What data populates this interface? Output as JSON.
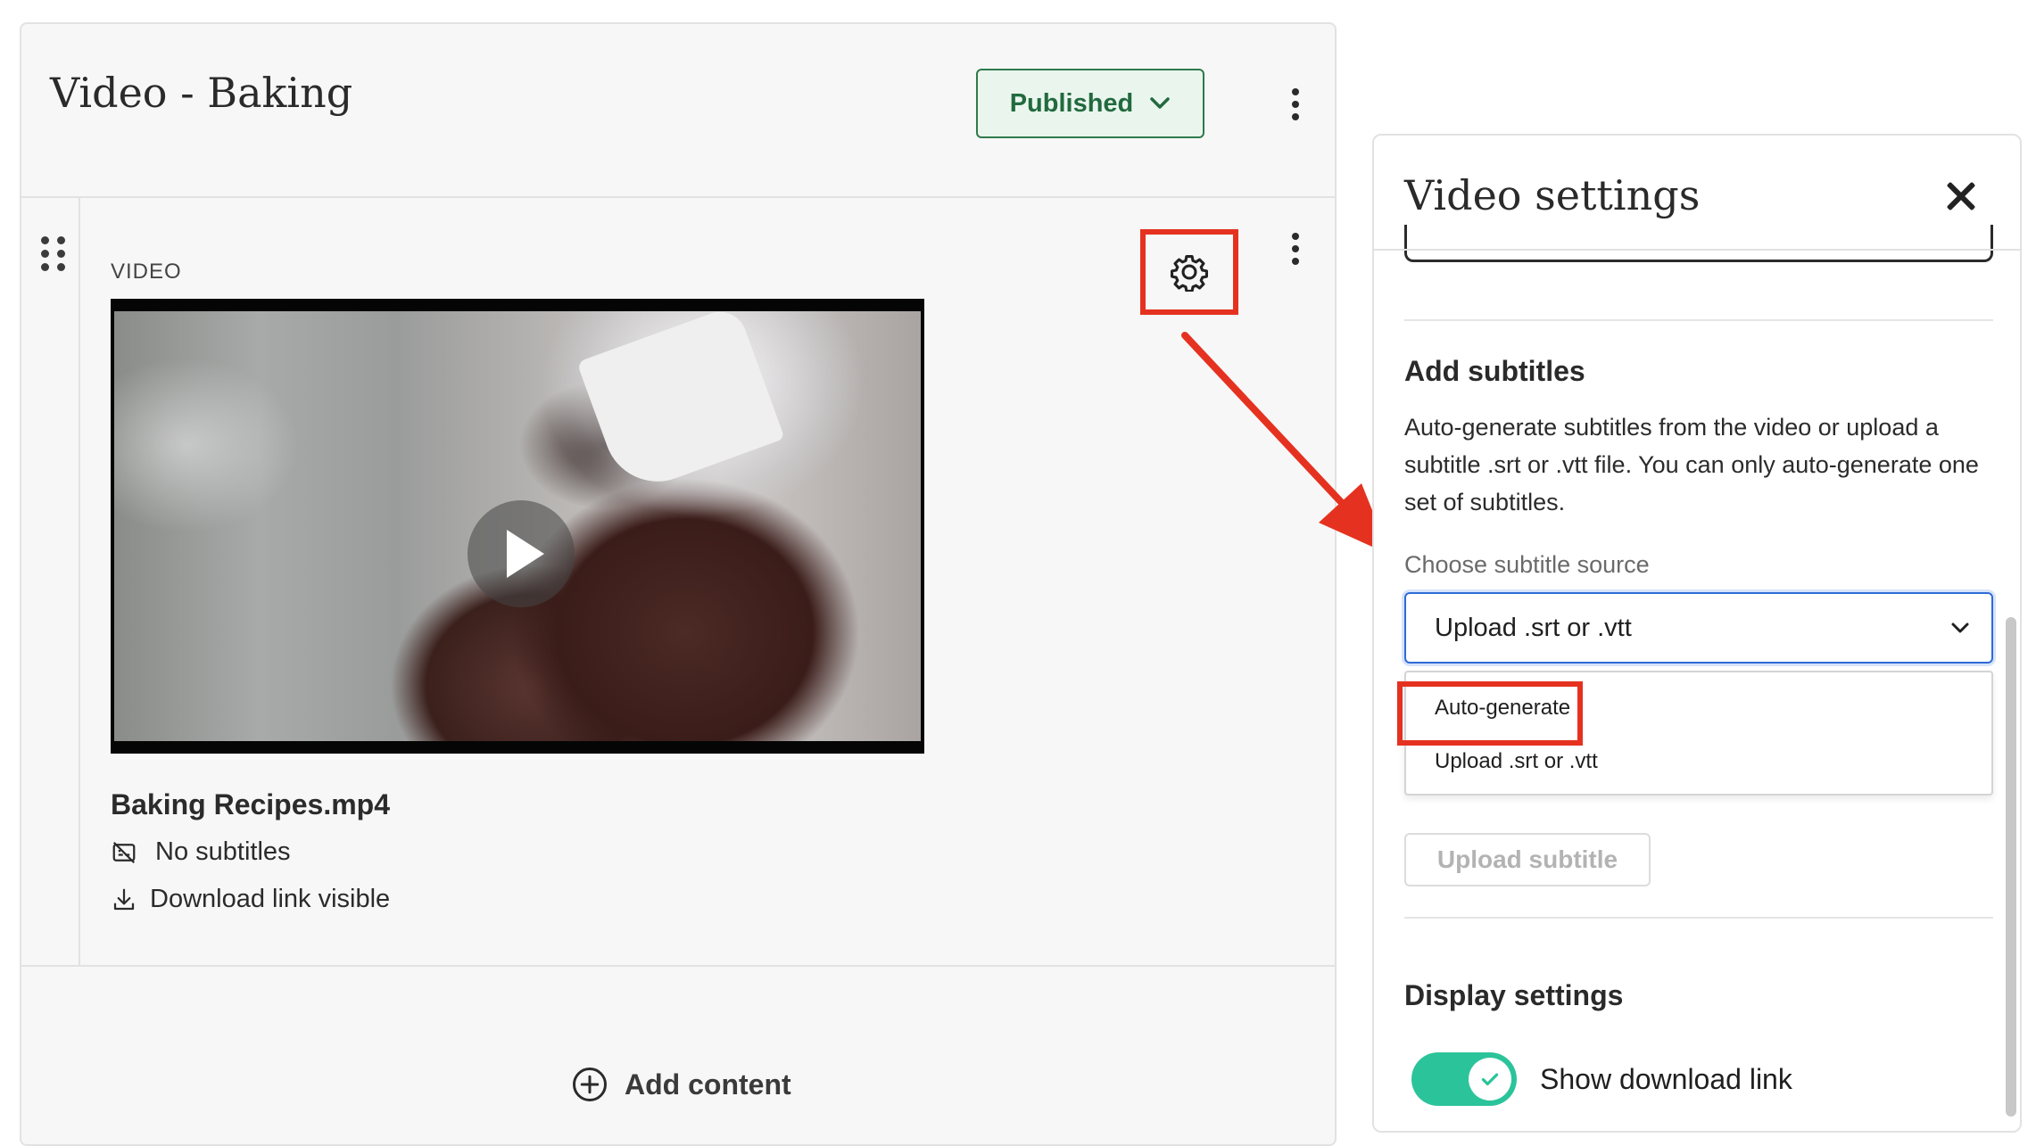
{
  "editor": {
    "title": "Video - Baking",
    "status_label": "Published",
    "block": {
      "label": "VIDEO",
      "file_name": "Baking Recipes.mp4",
      "subtitles_status": "No subtitles",
      "download_status": "Download link visible"
    },
    "add_content_label": "Add content"
  },
  "settings_panel": {
    "title": "Video settings",
    "subtitles": {
      "heading": "Add subtitles",
      "description": "Auto-generate subtitles from the video or upload a subtitle .srt or .vtt file. You can only auto-generate one set of subtitles.",
      "source_label": "Choose subtitle source",
      "selected": "Upload .srt or .vtt",
      "options": [
        "Auto-generate",
        "Upload .srt or .vtt"
      ],
      "upload_button": "Upload subtitle"
    },
    "display": {
      "heading": "Display settings",
      "show_download_label": "Show download link",
      "show_download_enabled": true
    }
  },
  "colors": {
    "highlight": "#e53220",
    "published_green": "#226a3e",
    "toggle_on": "#2bc49a",
    "focus_blue": "#2e6bd6"
  },
  "icons": [
    "chevron-down-icon",
    "kebab-menu-icon",
    "drag-handle-icon",
    "gear-icon",
    "play-icon",
    "no-subtitles-icon",
    "download-icon",
    "plus-circle-icon",
    "close-icon",
    "check-icon"
  ]
}
